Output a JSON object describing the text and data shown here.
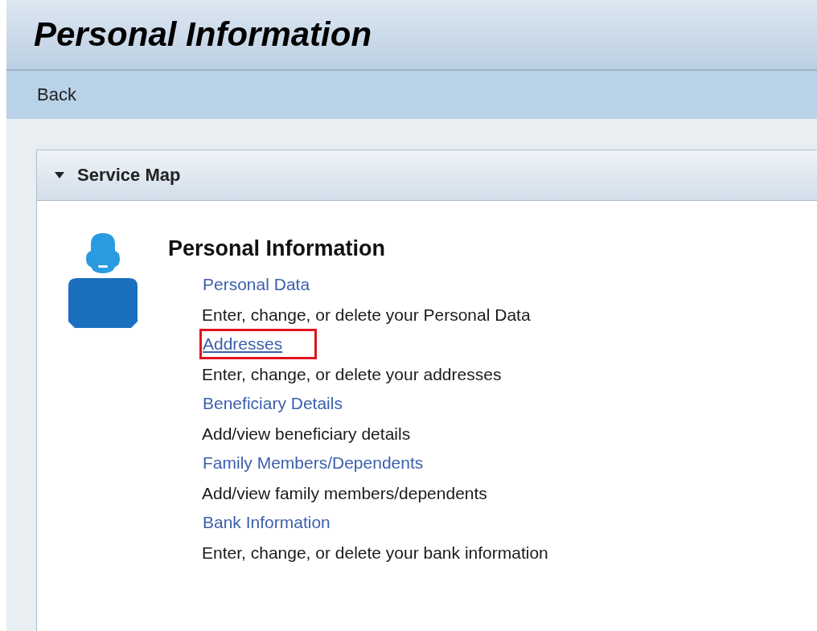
{
  "page": {
    "title": "Personal Information"
  },
  "toolbar": {
    "back": "Back"
  },
  "panel": {
    "title": "Service Map",
    "expanded": true
  },
  "section": {
    "title": "Personal Information",
    "services": [
      {
        "link": "Personal Data",
        "description": "Enter, change, or delete your Personal Data",
        "highlighted": false
      },
      {
        "link": "Addresses",
        "description": "Enter, change, or delete your addresses",
        "highlighted": true
      },
      {
        "link": "Beneficiary Details",
        "description": "Add/view beneficiary details",
        "highlighted": false
      },
      {
        "link": "Family Members/Dependents",
        "description": "Add/view family members/dependents",
        "highlighted": false
      },
      {
        "link": "Bank Information",
        "description": "Enter, change, or delete your bank information",
        "highlighted": false
      }
    ]
  }
}
